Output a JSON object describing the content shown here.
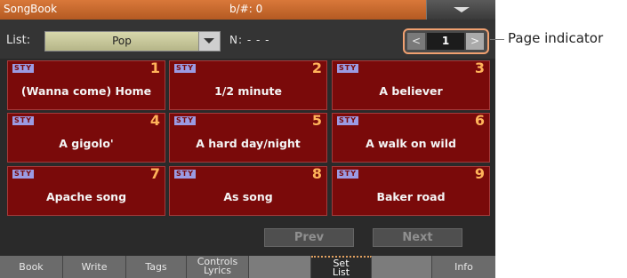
{
  "titlebar": {
    "title": "SongBook",
    "key": "b/#: 0"
  },
  "list": {
    "label": "List:",
    "value": "Pop",
    "n_label": "N: - - -"
  },
  "pager": {
    "prev": "<",
    "page": "1",
    "next": ">"
  },
  "songs": [
    {
      "tag": "STY",
      "number": "1",
      "name": "(Wanna come) Home"
    },
    {
      "tag": "STY",
      "number": "2",
      "name": "1/2 minute"
    },
    {
      "tag": "STY",
      "number": "3",
      "name": "A believer"
    },
    {
      "tag": "STY",
      "number": "4",
      "name": "A gigolo'"
    },
    {
      "tag": "STY",
      "number": "5",
      "name": "A hard day/night"
    },
    {
      "tag": "STY",
      "number": "6",
      "name": "A walk on wild"
    },
    {
      "tag": "STY",
      "number": "7",
      "name": "Apache song"
    },
    {
      "tag": "STY",
      "number": "8",
      "name": "As song"
    },
    {
      "tag": "STY",
      "number": "9",
      "name": "Baker road"
    }
  ],
  "nav": {
    "prev": "Prev",
    "next": "Next"
  },
  "tabs": {
    "book": "Book",
    "write": "Write",
    "tags": "Tags",
    "controls": "Controls",
    "lyrics": "Lyrics",
    "set": "Set",
    "list": "List",
    "info": "Info"
  },
  "callout": {
    "label": "Page indicator"
  },
  "colors": {
    "titlebar": "#c4662c",
    "card": "#7a0a0a",
    "card_number": "#ffb35a",
    "highlight": "#f0a070"
  }
}
